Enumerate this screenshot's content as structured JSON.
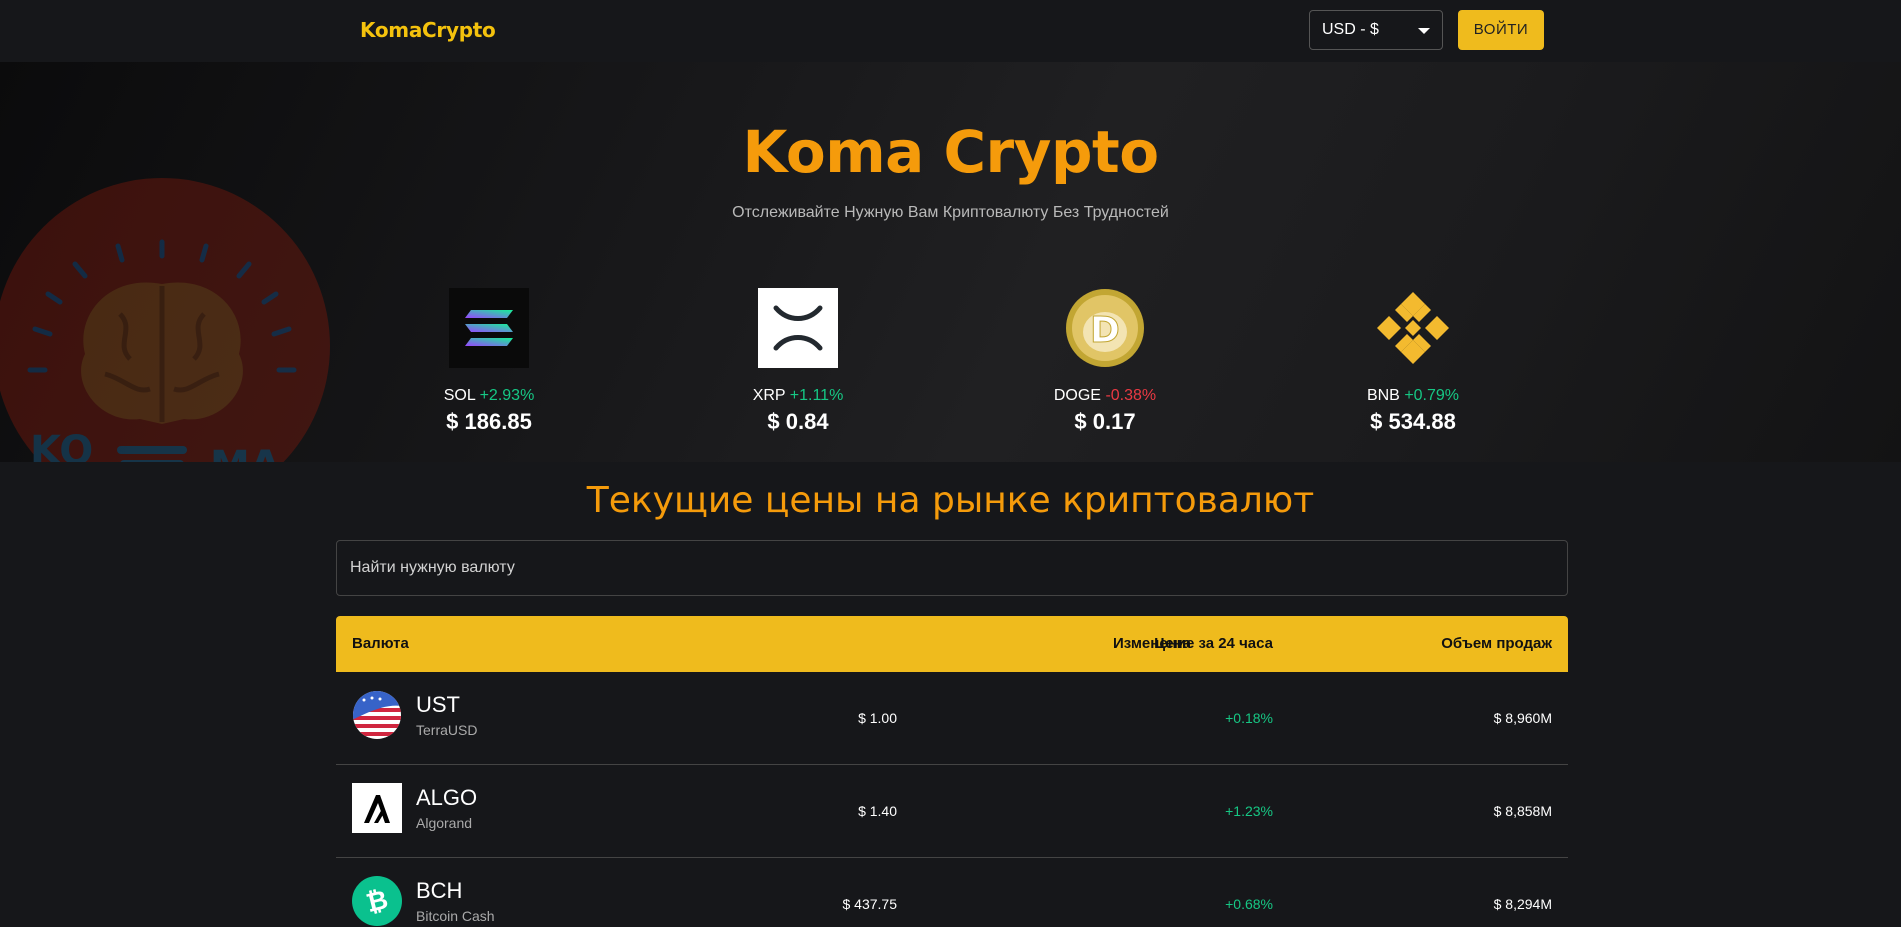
{
  "header": {
    "logo": "KomaCrypto",
    "currency": "USD - $",
    "login": "ВОЙТИ"
  },
  "hero": {
    "title": "Koma Crypto",
    "subtitle": "Отслеживайте Нужную Вам Криптовалюту Без Трудностей",
    "logo_text_left": "KO",
    "logo_text_right": "MA",
    "coins": [
      {
        "symbol": "SOL",
        "change": "+2.93%",
        "direction": "up",
        "price": "$ 186.85",
        "icon": "solana-icon"
      },
      {
        "symbol": "XRP",
        "change": "+1.11%",
        "direction": "up",
        "price": "$ 0.84",
        "icon": "xrp-icon"
      },
      {
        "symbol": "DOGE",
        "change": "-0.38%",
        "direction": "down",
        "price": "$ 0.17",
        "icon": "dogecoin-icon"
      },
      {
        "symbol": "BNB",
        "change": "+0.79%",
        "direction": "up",
        "price": "$ 534.88",
        "icon": "bnb-icon"
      }
    ]
  },
  "market": {
    "title": "Текущие цены на рынке криптовалют",
    "search_placeholder": "Найти нужную валюту",
    "columns": {
      "coin": "Валюта",
      "price": "Цена",
      "change": "Изменение за 24 часа",
      "volume": "Объем продаж"
    },
    "rows": [
      {
        "symbol": "UST",
        "name": "TerraUSD",
        "price": "$ 1.00",
        "change": "+0.18%",
        "volume": "$ 8,960M",
        "icon": "terrausd-icon"
      },
      {
        "symbol": "ALGO",
        "name": "Algorand",
        "price": "$ 1.40",
        "change": "+1.23%",
        "volume": "$ 8,858M",
        "icon": "algorand-icon"
      },
      {
        "symbol": "BCH",
        "name": "Bitcoin Cash",
        "price": "$ 437.75",
        "change": "+0.68%",
        "volume": "$ 8,294M",
        "icon": "bitcoin-cash-icon"
      }
    ]
  },
  "colors": {
    "accent": "#efbb1d",
    "title_orange": "#f59b0b",
    "positive": "#16c784",
    "negative": "#ea3943",
    "background": "#16171a"
  }
}
